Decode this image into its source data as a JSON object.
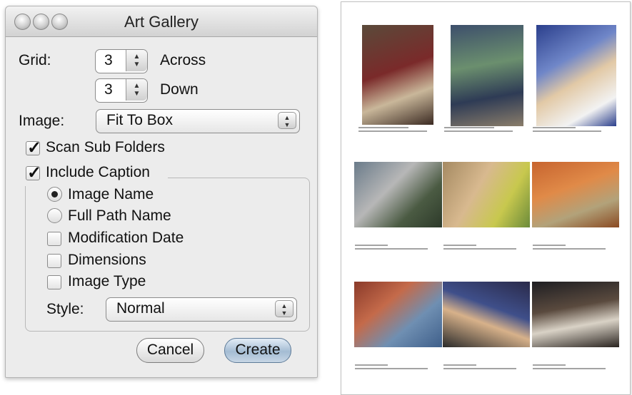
{
  "window": {
    "title": "Art Gallery"
  },
  "grid": {
    "label": "Grid:",
    "across_value": "3",
    "across_label": "Across",
    "down_value": "3",
    "down_label": "Down"
  },
  "image": {
    "label": "Image:",
    "selected": "Fit To Box"
  },
  "options": {
    "scan_sub_folders": {
      "label": "Scan Sub Folders",
      "checked": true
    },
    "include_caption": {
      "label": "Include Caption",
      "checked": true
    }
  },
  "caption": {
    "image_name": {
      "label": "Image Name",
      "selected": true
    },
    "full_path_name": {
      "label": "Full Path Name",
      "selected": false
    },
    "modification_date": {
      "label": "Modification Date",
      "checked": false
    },
    "dimensions": {
      "label": "Dimensions",
      "checked": false
    },
    "image_type": {
      "label": "Image Type",
      "checked": false
    },
    "style_label": "Style:",
    "style_selected": "Normal"
  },
  "buttons": {
    "cancel": "Cancel",
    "create": "Create"
  },
  "icons": {
    "stepper": "up-down-arrows-icon",
    "popup": "popup-arrows-icon",
    "checkmark": "checkmark-icon"
  },
  "colors": {
    "window_bg": "#ececec",
    "default_button": "#a4bcd3",
    "page_bg": "#ffffff"
  }
}
